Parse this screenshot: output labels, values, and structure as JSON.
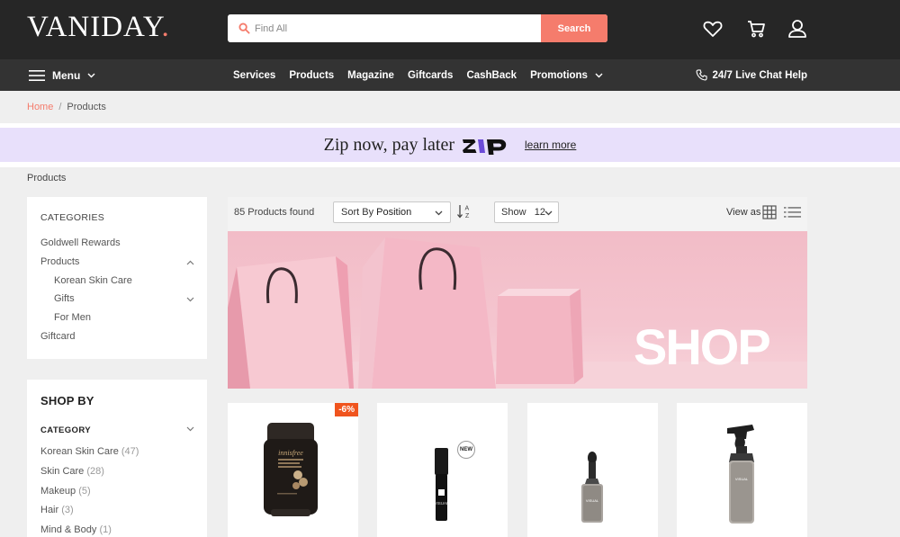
{
  "brand": {
    "name": "VANIDAY",
    "dot": "."
  },
  "search": {
    "placeholder": "Find All",
    "button": "Search"
  },
  "header_icons": [
    "heart-icon",
    "cart-icon",
    "user-icon"
  ],
  "nav": {
    "menu_label": "Menu",
    "links": [
      "Services",
      "Products",
      "Magazine",
      "Giftcards",
      "CashBack",
      "Promotions"
    ],
    "chat_label": "24/7 Live Chat Help"
  },
  "breadcrumb": {
    "home": "Home",
    "sep": "/",
    "current": "Products"
  },
  "zip_banner": {
    "text": "Zip now, pay later",
    "logo": "zip",
    "link": "learn more"
  },
  "page_label": "Products",
  "categories": {
    "title": "CATEGORIES",
    "items": [
      {
        "label": "Goldwell Rewards"
      },
      {
        "label": "Products"
      },
      {
        "label": "Korean Skin Care"
      },
      {
        "label": "Gifts"
      },
      {
        "label": "For Men"
      },
      {
        "label": "Giftcard"
      }
    ]
  },
  "shop_by": {
    "title": "SHOP BY",
    "category_heading": "CATEGORY",
    "items": [
      {
        "label": "Korean Skin Care",
        "count": "(47)"
      },
      {
        "label": "Skin Care",
        "count": "(28)"
      },
      {
        "label": "Makeup",
        "count": "(5)"
      },
      {
        "label": "Hair",
        "count": "(3)"
      },
      {
        "label": "Mind & Body",
        "count": "(1)"
      }
    ]
  },
  "toolbar": {
    "found": "85 Products found",
    "sort_label": "Sort By",
    "sort_value": "Position",
    "show_label": "Show",
    "show_value": "12",
    "view_as": "View as"
  },
  "banner": {
    "text": "SHOP"
  },
  "products": [
    {
      "badge": "-6%",
      "product_text": "innisfree"
    },
    {
      "badge": "NEW",
      "product_text": "VISUAL"
    },
    {
      "badge": "",
      "product_text": "VISUAL"
    },
    {
      "badge": "",
      "product_text": "VISUAL"
    }
  ],
  "colors": {
    "accent": "#f57c6c",
    "header": "#262626",
    "nav": "#333333",
    "sale": "#f0541e",
    "zip_bg": "#e8e0fb"
  }
}
